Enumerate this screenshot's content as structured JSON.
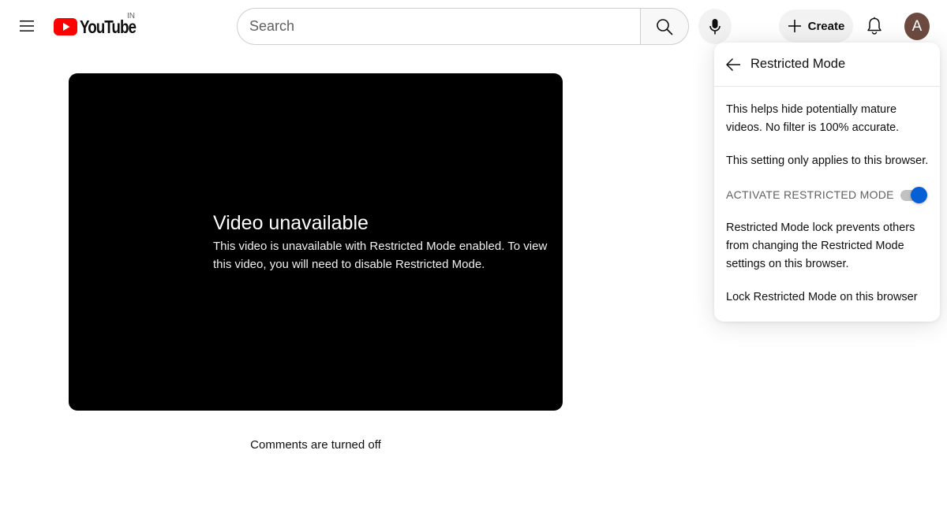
{
  "masthead": {
    "logo_text": "YouTube",
    "country_code": "IN",
    "search_placeholder": "Search",
    "create_label": "Create",
    "avatar_initial": "A",
    "colors": {
      "logo_red": "#ff0000",
      "avatar_bg": "#6d4a3f"
    },
    "icons": [
      "menu-icon",
      "search-icon",
      "mic-icon",
      "plus-icon",
      "bell-icon"
    ]
  },
  "player": {
    "title": "Video unavailable",
    "description": "This video is unavailable with Restricted Mode enabled. To view this video, you will need to disable Restricted Mode."
  },
  "comments_status": "Comments are turned off",
  "restricted_panel": {
    "title": "Restricted Mode",
    "description_1": "This helps hide potentially mature videos. No filter is 100% accurate.",
    "description_2": "This setting only applies to this browser.",
    "toggle_label": "ACTIVATE RESTRICTED MODE",
    "toggle_on": true,
    "lock_description": "Restricted Mode lock prevents others from changing the Restricted Mode settings on this browser.",
    "lock_link": "Lock Restricted Mode on this browser",
    "colors": {
      "toggle_active": "#065fd4"
    }
  }
}
